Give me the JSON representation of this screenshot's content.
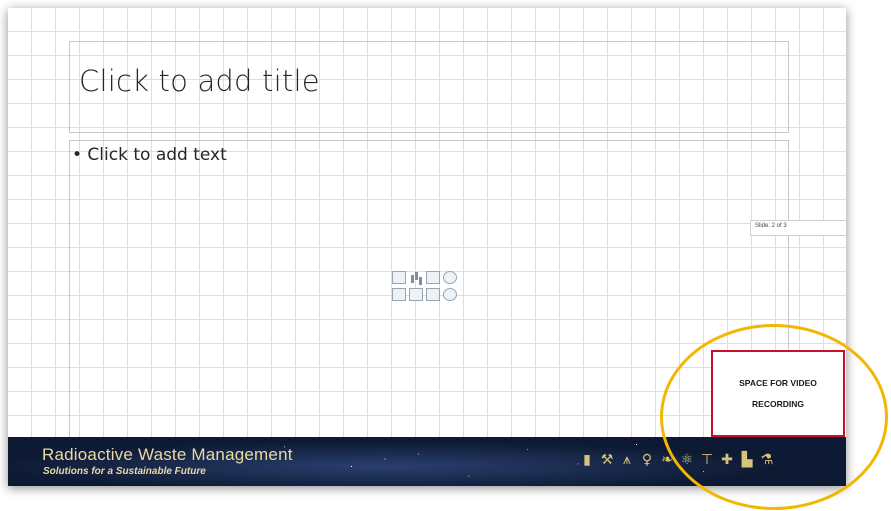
{
  "slide": {
    "title_placeholder": "Click to add title",
    "body_placeholder": "• Click to add text",
    "slide_indicator": "Slide: 2 of 3",
    "video_note": {
      "line1": "SPACE FOR VIDEO",
      "line2": "RECORDING"
    },
    "footer": {
      "title": "Radioactive Waste Management",
      "subtitle": "Solutions for a Sustainable Future",
      "icons": [
        "barrel-icon",
        "pickaxe-icon",
        "power-pylon-icon",
        "lightbulb-icon",
        "leaf-icon",
        "atom-icon",
        "crane-icon",
        "medical-kit-icon",
        "factory-icon",
        "flask-icon"
      ]
    }
  },
  "colors": {
    "accent_highlight": "#f2b705",
    "video_box_border": "#c8102e",
    "footer_text": "#e9d9a1",
    "footer_bg": "#0e1a33"
  }
}
